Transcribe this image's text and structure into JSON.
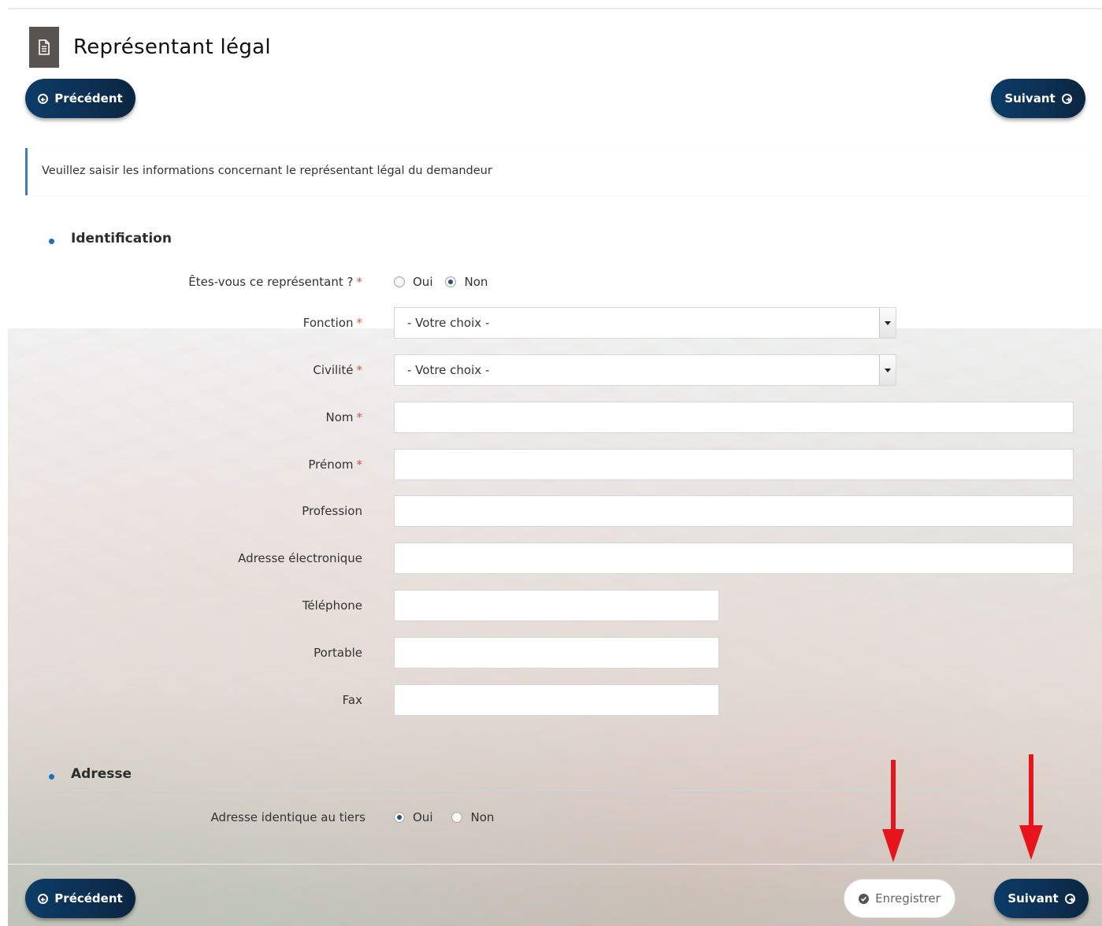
{
  "page": {
    "title": "Représentant légal"
  },
  "nav": {
    "previous_label": "Précédent",
    "next_label": "Suivant"
  },
  "info": {
    "message": "Veuillez saisir les informations concernant le représentant légal du demandeur"
  },
  "identification": {
    "section_title": "Identification",
    "is_representative": {
      "label": "Êtes-vous ce représentant ?",
      "required_mark": "*",
      "options": [
        "Oui",
        "Non"
      ],
      "selected": "Non"
    },
    "fonction": {
      "label": "Fonction",
      "required_mark": "*",
      "value": "- Votre choix -"
    },
    "civilite": {
      "label": "Civilité",
      "required_mark": "*",
      "value": "- Votre choix -"
    },
    "nom": {
      "label": "Nom",
      "required_mark": "*",
      "value": ""
    },
    "prenom": {
      "label": "Prénom",
      "required_mark": "*",
      "value": ""
    },
    "profession": {
      "label": "Profession",
      "value": ""
    },
    "email": {
      "label": "Adresse électronique",
      "value": ""
    },
    "telephone": {
      "label": "Téléphone",
      "value": ""
    },
    "portable": {
      "label": "Portable",
      "value": ""
    },
    "fax": {
      "label": "Fax",
      "value": ""
    }
  },
  "adresse": {
    "section_title": "Adresse",
    "same_as_tiers": {
      "label": "Adresse identique au tiers",
      "options": [
        "Oui",
        "Non"
      ],
      "selected": "Oui"
    }
  },
  "footer": {
    "save_label": "Enregistrer",
    "previous_label": "Précédent",
    "next_label": "Suivant"
  },
  "colors": {
    "primary_button": "#0d2f52",
    "accent": "#1d6fb8",
    "required": "#d9534f",
    "annotation_arrow": "#e8141c"
  }
}
